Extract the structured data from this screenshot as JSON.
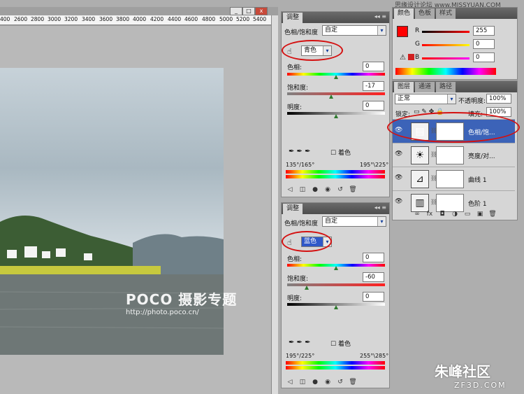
{
  "window": {
    "buttons": [
      "_",
      "□",
      "x"
    ]
  },
  "ruler": {
    "labels": [
      "400",
      "2600",
      "2800",
      "3000",
      "3200",
      "3400",
      "3600",
      "3800",
      "4000",
      "4200",
      "4400",
      "4600",
      "4800",
      "5000",
      "5200",
      "5400"
    ]
  },
  "watermark": {
    "brand": "POCO 摄影专题",
    "url": "http://photo.poco.cn/"
  },
  "corner_brand": {
    "site": "朱峰社区",
    "url": "ZF3D.COM"
  },
  "header_watermark": "思缘设计论坛 www.MISSYUAN.COM",
  "adjust1": {
    "tab": "调整",
    "title": "色相/饱和度",
    "preset": "自定",
    "channel": "青色",
    "hue_label": "色相:",
    "hue": "0",
    "sat_label": "饱和度:",
    "sat": "-17",
    "light_label": "明度:",
    "light": "0",
    "colorize": "着色",
    "range_left": "135°/165°",
    "range_right": "195°\\225°",
    "hue_thumb": 0.5,
    "sat_thumb": 0.45,
    "light_thumb": 0.5
  },
  "adjust2": {
    "tab": "调整",
    "title": "色相/饱和度",
    "preset": "自定",
    "channel": "蓝色",
    "hue_label": "色相:",
    "hue": "0",
    "sat_label": "饱和度:",
    "sat": "-60",
    "light_label": "明度:",
    "light": "0",
    "colorize": "着色",
    "range_left": "195°/225°",
    "range_right": "255°\\285°",
    "hue_thumb": 0.5,
    "sat_thumb": 0.2,
    "light_thumb": 0.5
  },
  "color": {
    "tabs": [
      "颜色",
      "色板",
      "样式"
    ],
    "r": "255",
    "g": "0",
    "b": "0",
    "r_label": "R",
    "g_label": "G",
    "b_label": "B",
    "fg": "#ff0000"
  },
  "layers": {
    "tabs": [
      "图层",
      "通道",
      "路径"
    ],
    "blend": "正常",
    "opacity_label": "不透明度:",
    "opacity": "100%",
    "lock_label": "锁定:",
    "fill_label": "填充:",
    "fill": "100%",
    "items": [
      {
        "name": "色相/饱...",
        "icon": "▤"
      },
      {
        "name": "亮度/对...",
        "icon": "☀"
      },
      {
        "name": "曲线 1",
        "icon": "⊿"
      },
      {
        "name": "色阶 1",
        "icon": "▥"
      }
    ]
  }
}
